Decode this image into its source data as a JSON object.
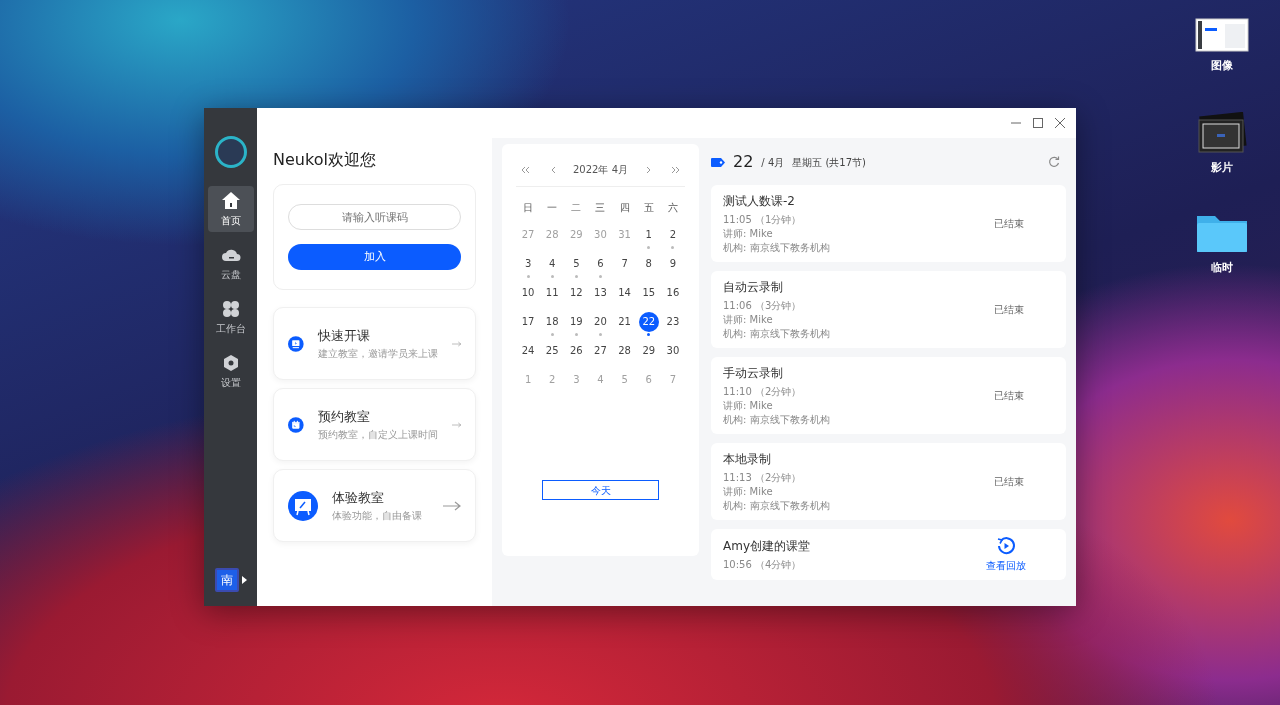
{
  "desktop_icons": [
    {
      "label": "图像",
      "kind": "screenshot"
    },
    {
      "label": "影片",
      "kind": "movie"
    },
    {
      "label": "临时",
      "kind": "folder"
    }
  ],
  "sidebar": {
    "items": [
      {
        "label": "首页",
        "kind": "home",
        "selected": true
      },
      {
        "label": "云盘",
        "kind": "cloud",
        "selected": false
      },
      {
        "label": "工作台",
        "kind": "apps",
        "selected": false
      },
      {
        "label": "设置",
        "kind": "settings",
        "selected": false
      }
    ],
    "org_badge": "南"
  },
  "welcome": {
    "title": "Neukol欢迎您",
    "code_field": {
      "placeholder": "请输入听课码"
    },
    "join_button": "加入"
  },
  "actions": [
    {
      "title": "快速开课",
      "subtitle": "建立教室，邀请学员来上课",
      "kind": "screen"
    },
    {
      "title": "预约教室",
      "subtitle": "预约教室，自定义上课时间",
      "kind": "calendar"
    },
    {
      "title": "体验教室",
      "subtitle": "体验功能，自由备课",
      "kind": "board"
    }
  ],
  "calendar": {
    "month_label": "2022年 4月",
    "weekdays": [
      "日",
      "一",
      "二",
      "三",
      "四",
      "五",
      "六"
    ],
    "weeks": [
      [
        {
          "day": "27",
          "muted": true,
          "dot": false,
          "selected": false
        },
        {
          "day": "28",
          "muted": true,
          "dot": false,
          "selected": false
        },
        {
          "day": "29",
          "muted": true,
          "dot": false,
          "selected": false
        },
        {
          "day": "30",
          "muted": true,
          "dot": false,
          "selected": false
        },
        {
          "day": "31",
          "muted": true,
          "dot": false,
          "selected": false
        },
        {
          "day": "1",
          "muted": false,
          "dot": true,
          "selected": false
        },
        {
          "day": "2",
          "muted": false,
          "dot": true,
          "selected": false
        }
      ],
      [
        {
          "day": "3",
          "muted": false,
          "dot": true,
          "selected": false
        },
        {
          "day": "4",
          "muted": false,
          "dot": true,
          "selected": false
        },
        {
          "day": "5",
          "muted": false,
          "dot": true,
          "selected": false
        },
        {
          "day": "6",
          "muted": false,
          "dot": true,
          "selected": false
        },
        {
          "day": "7",
          "muted": false,
          "dot": false,
          "selected": false
        },
        {
          "day": "8",
          "muted": false,
          "dot": false,
          "selected": false
        },
        {
          "day": "9",
          "muted": false,
          "dot": false,
          "selected": false
        }
      ],
      [
        {
          "day": "10",
          "muted": false,
          "dot": false,
          "selected": false
        },
        {
          "day": "11",
          "muted": false,
          "dot": false,
          "selected": false
        },
        {
          "day": "12",
          "muted": false,
          "dot": false,
          "selected": false
        },
        {
          "day": "13",
          "muted": false,
          "dot": false,
          "selected": false
        },
        {
          "day": "14",
          "muted": false,
          "dot": false,
          "selected": false
        },
        {
          "day": "15",
          "muted": false,
          "dot": false,
          "selected": false
        },
        {
          "day": "16",
          "muted": false,
          "dot": false,
          "selected": false
        }
      ],
      [
        {
          "day": "17",
          "muted": false,
          "dot": false,
          "selected": false
        },
        {
          "day": "18",
          "muted": false,
          "dot": true,
          "selected": false
        },
        {
          "day": "19",
          "muted": false,
          "dot": true,
          "selected": false
        },
        {
          "day": "20",
          "muted": false,
          "dot": true,
          "selected": false
        },
        {
          "day": "21",
          "muted": false,
          "dot": false,
          "selected": false
        },
        {
          "day": "22",
          "muted": false,
          "dot": true,
          "selected": true
        },
        {
          "day": "23",
          "muted": false,
          "dot": false,
          "selected": false
        }
      ],
      [
        {
          "day": "24",
          "muted": false,
          "dot": false,
          "selected": false
        },
        {
          "day": "25",
          "muted": false,
          "dot": false,
          "selected": false
        },
        {
          "day": "26",
          "muted": false,
          "dot": false,
          "selected": false
        },
        {
          "day": "27",
          "muted": false,
          "dot": false,
          "selected": false
        },
        {
          "day": "28",
          "muted": false,
          "dot": false,
          "selected": false
        },
        {
          "day": "29",
          "muted": false,
          "dot": false,
          "selected": false
        },
        {
          "day": "30",
          "muted": false,
          "dot": false,
          "selected": false
        }
      ],
      [
        {
          "day": "1",
          "muted": true,
          "dot": false,
          "selected": false
        },
        {
          "day": "2",
          "muted": true,
          "dot": false,
          "selected": false
        },
        {
          "day": "3",
          "muted": true,
          "dot": false,
          "selected": false
        },
        {
          "day": "4",
          "muted": true,
          "dot": false,
          "selected": false
        },
        {
          "day": "5",
          "muted": true,
          "dot": false,
          "selected": false
        },
        {
          "day": "6",
          "muted": true,
          "dot": false,
          "selected": false
        },
        {
          "day": "7",
          "muted": true,
          "dot": false,
          "selected": false
        }
      ]
    ],
    "today_button": "今天"
  },
  "schedule": {
    "day": "22",
    "month": "/ 4月",
    "weekday_info": "星期五 (共17节)",
    "lessons": [
      {
        "title": "测试人数课-2",
        "time": "11:05 （1分钟）",
        "teacher": "讲师: Mike",
        "org": "机构: 南京线下教务机构",
        "status": {
          "kind": "ended",
          "label": "已结束"
        }
      },
      {
        "title": "自动云录制",
        "time": "11:06 （3分钟）",
        "teacher": "讲师: Mike",
        "org": "机构: 南京线下教务机构",
        "status": {
          "kind": "ended",
          "label": "已结束"
        }
      },
      {
        "title": "手动云录制",
        "time": "11:10 （2分钟）",
        "teacher": "讲师: Mike",
        "org": "机构: 南京线下教务机构",
        "status": {
          "kind": "ended",
          "label": "已结束"
        }
      },
      {
        "title": "本地录制",
        "time": "11:13 （2分钟）",
        "teacher": "讲师: Mike",
        "org": "机构: 南京线下教务机构",
        "status": {
          "kind": "ended",
          "label": "已结束"
        }
      },
      {
        "title": "Amy创建的课堂",
        "time": "10:56 （4分钟）",
        "status": {
          "kind": "replay",
          "label": "查看回放"
        }
      }
    ]
  }
}
